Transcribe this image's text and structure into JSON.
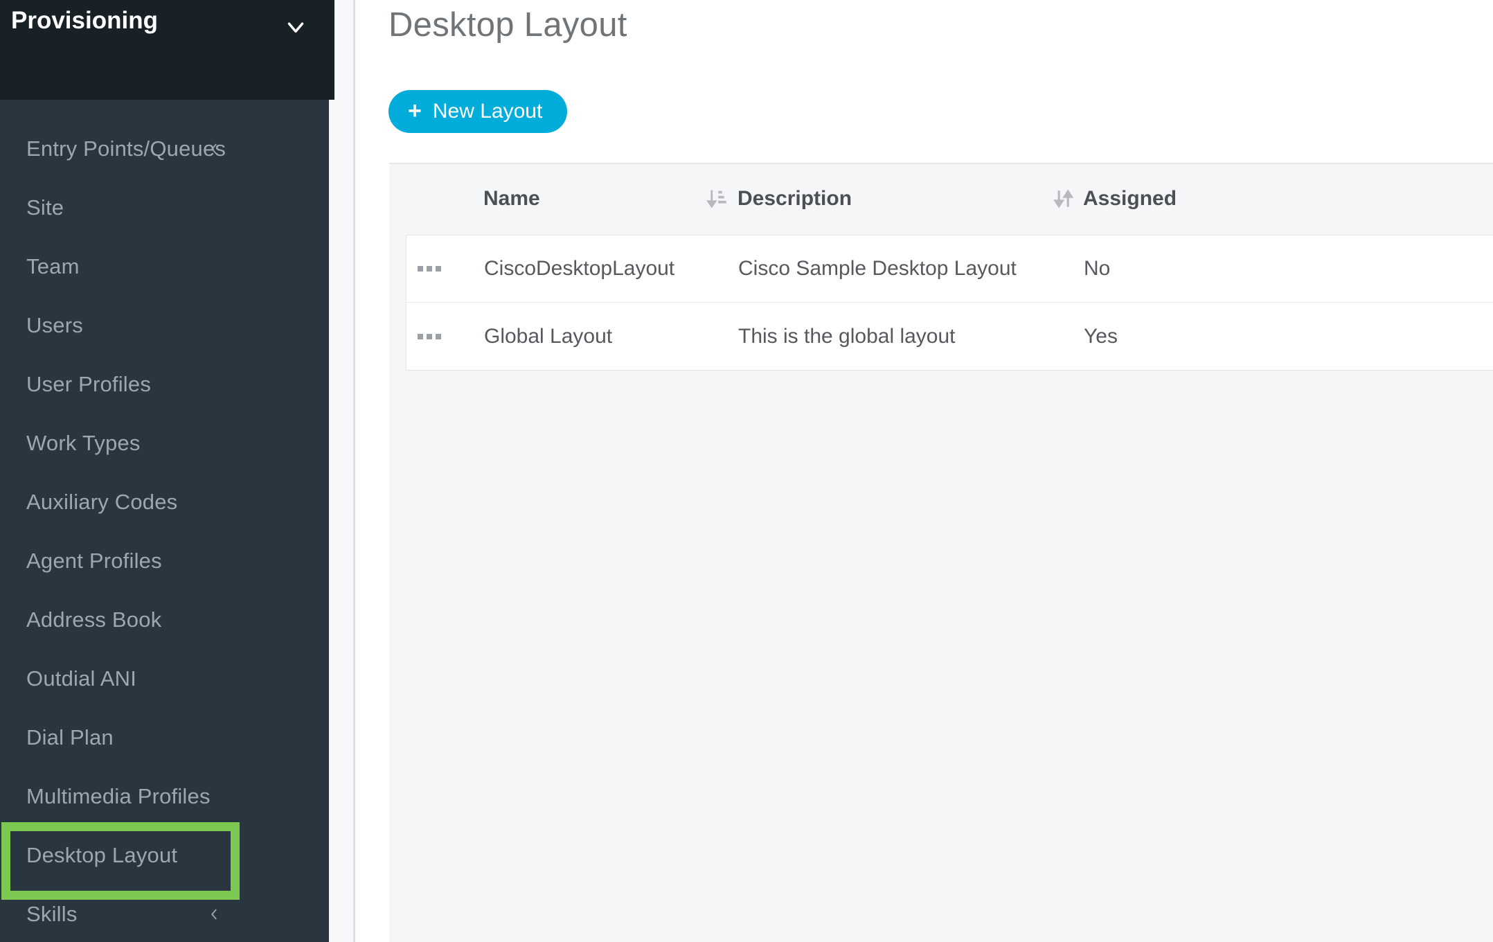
{
  "sidebar": {
    "header": {
      "title": "Provisioning",
      "chevron_icon": "chevron-down-icon"
    },
    "items": [
      {
        "label": "Entry Points/Queues",
        "chevron": true,
        "chevron_icon": "chevron-left-icon",
        "highlighted": false
      },
      {
        "label": "Site",
        "chevron": false,
        "highlighted": false
      },
      {
        "label": "Team",
        "chevron": false,
        "highlighted": false
      },
      {
        "label": "Users",
        "chevron": false,
        "highlighted": false
      },
      {
        "label": "User Profiles",
        "chevron": false,
        "highlighted": false
      },
      {
        "label": "Work Types",
        "chevron": false,
        "highlighted": false
      },
      {
        "label": "Auxiliary Codes",
        "chevron": false,
        "highlighted": false
      },
      {
        "label": "Agent Profiles",
        "chevron": false,
        "highlighted": false
      },
      {
        "label": "Address Book",
        "chevron": false,
        "highlighted": false
      },
      {
        "label": "Outdial ANI",
        "chevron": false,
        "highlighted": false
      },
      {
        "label": "Dial Plan",
        "chevron": false,
        "highlighted": false
      },
      {
        "label": "Multimedia Profiles",
        "chevron": false,
        "highlighted": false
      },
      {
        "label": "Desktop Layout",
        "chevron": false,
        "highlighted": true
      },
      {
        "label": "Skills",
        "chevron": true,
        "chevron_icon": "chevron-left-icon",
        "highlighted": false
      }
    ]
  },
  "main": {
    "page_title": "Desktop Layout",
    "new_layout_button": {
      "label": "New Layout",
      "plus": "+",
      "icon": "plus-icon"
    },
    "table": {
      "columns": [
        {
          "label": "Name",
          "sort_icon": "sort-ascending-icon"
        },
        {
          "label": "Description",
          "sort_icon": "sort-unsorted-icon"
        },
        {
          "label": "Assigned",
          "sort_icon": null
        }
      ],
      "rows": [
        {
          "actions_icon": "ellipsis-icon",
          "name": "CiscoDesktopLayout",
          "description": "Cisco Sample Desktop Layout",
          "assigned": "No"
        },
        {
          "actions_icon": "ellipsis-icon",
          "name": "Global Layout",
          "description": "This is the global layout",
          "assigned": "Yes"
        }
      ]
    }
  },
  "annotation": {
    "highlight_color": "#7dc850",
    "highlight_target": "Desktop Layout"
  },
  "colors": {
    "sidebar_header_bg": "#182226",
    "sidebar_nav_bg": "#293640",
    "sidebar_text": "#9aa8b0",
    "accent_button": "#00adda",
    "content_bg": "#f5f6f8",
    "title_text": "#6f7478"
  }
}
